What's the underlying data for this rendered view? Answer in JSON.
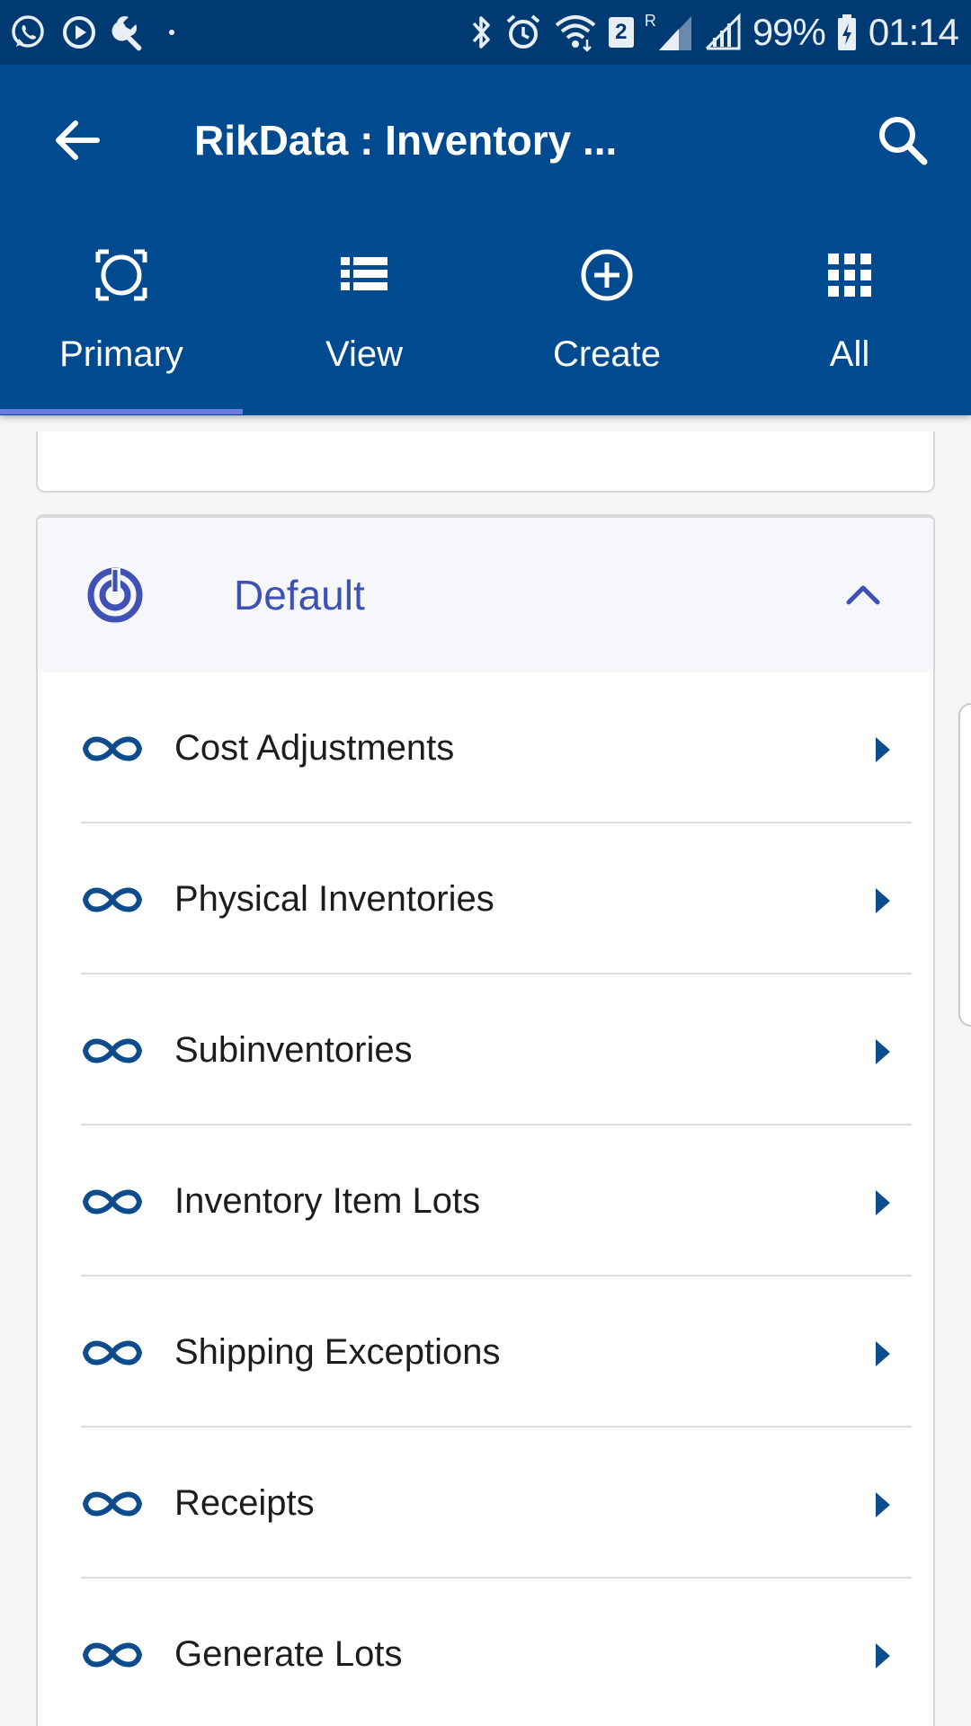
{
  "status_bar": {
    "battery": "99%",
    "time": "01:14",
    "notification_badge": "2",
    "roaming_mark": "R"
  },
  "app_bar": {
    "title": "RikData : Inventory ...",
    "back_icon": "arrow-left-icon",
    "search_icon": "search-icon"
  },
  "tabs": [
    {
      "label": "Primary",
      "icon": "target-circle-icon",
      "selected": true
    },
    {
      "label": "View",
      "icon": "list-icon",
      "selected": false
    },
    {
      "label": "Create",
      "icon": "add-circle-icon",
      "selected": false
    },
    {
      "label": "All",
      "icon": "apps-grid-icon",
      "selected": false
    }
  ],
  "section": {
    "title": "Default",
    "icon": "target-icon",
    "expanded": true
  },
  "items": [
    {
      "label": "Cost Adjustments",
      "icon": "infinity-icon"
    },
    {
      "label": "Physical Inventories",
      "icon": "infinity-icon"
    },
    {
      "label": "Subinventories",
      "icon": "infinity-icon"
    },
    {
      "label": "Inventory Item Lots",
      "icon": "infinity-icon"
    },
    {
      "label": "Shipping Exceptions",
      "icon": "infinity-icon"
    },
    {
      "label": "Receipts",
      "icon": "infinity-icon"
    },
    {
      "label": "Generate Lots",
      "icon": "infinity-icon"
    }
  ],
  "colors": {
    "status_bar": "#003a73",
    "app_bar": "#004a8f",
    "tab_indicator": "#6d7be0",
    "section_accent": "#3f51b5",
    "item_icon": "#0d4c8c"
  }
}
